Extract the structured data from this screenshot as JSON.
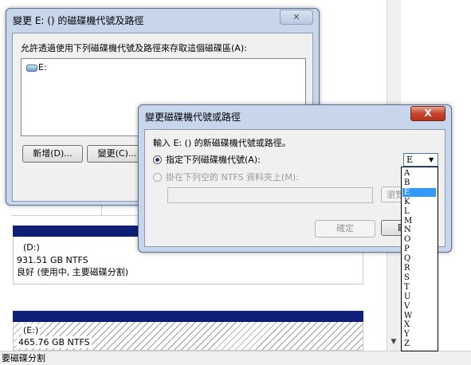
{
  "background": {
    "disk1": {
      "volume": "(D:)",
      "size": "931.51 GB NTFS",
      "status": "良好 (使用中, 主要磁碟分割)"
    },
    "disk2": {
      "volume": "(E:)",
      "size": "465.76 GB NTFS"
    },
    "status_bar": "要磁碟分割"
  },
  "dialog_back": {
    "title": "變更 E: () 的磁碟機代號及路徑",
    "description": "允許透過使用下列磁碟機代號及路徑來存取這個磁碟區(A):",
    "list_items": [
      {
        "icon": "drive-icon",
        "label": "E:"
      }
    ],
    "buttons": {
      "add": "新增(D)...",
      "change": "變更(C)..."
    }
  },
  "dialog_front": {
    "title": "變更磁碟機代號或路徑",
    "close_label": "X",
    "prompt": "輸入 E: () 的新磁碟機代號或路徑。",
    "option_letter": "指定下列磁碟機代號(A):",
    "option_folder": "掛在下列空的 NTFS 資料夾上(M):",
    "browse": "瀏覽",
    "ok": "確定",
    "cancel": "取",
    "selected_letter": "E"
  },
  "dropdown": {
    "options": [
      "A",
      "B",
      "E",
      "K",
      "L",
      "M",
      "N",
      "O",
      "P",
      "Q",
      "R",
      "S",
      "T",
      "U",
      "V",
      "W",
      "X",
      "Y",
      "Z"
    ],
    "selected_index": 2
  },
  "colors": {
    "disk_bar": "#0f1f78",
    "selection": "#3399ff",
    "window_frame": "#c7d6ea"
  }
}
